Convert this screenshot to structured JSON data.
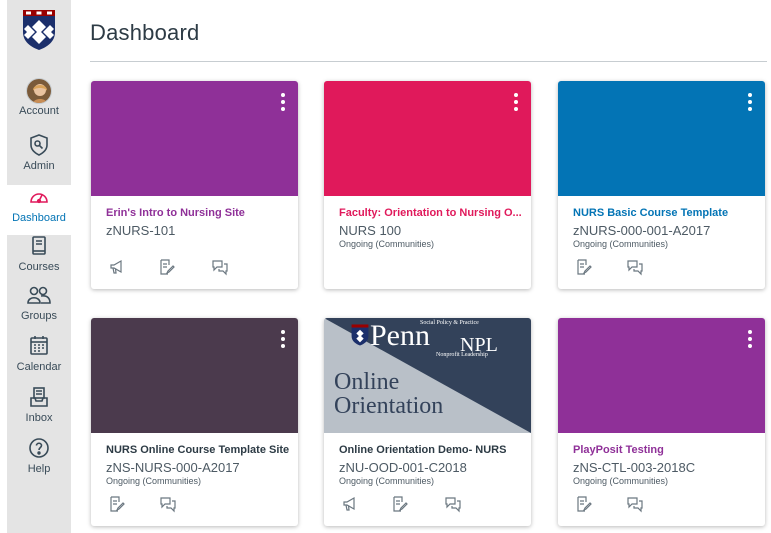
{
  "sidebar": {
    "items": [
      {
        "label": "Account",
        "icon": "avatar"
      },
      {
        "label": "Admin",
        "icon": "shield-icon"
      },
      {
        "label": "Dashboard",
        "icon": "gauge-icon"
      },
      {
        "label": "Courses",
        "icon": "book-icon"
      },
      {
        "label": "Groups",
        "icon": "people-icon"
      },
      {
        "label": "Calendar",
        "icon": "calendar-icon"
      },
      {
        "label": "Inbox",
        "icon": "inbox-icon"
      },
      {
        "label": "Help",
        "icon": "help-icon"
      }
    ],
    "active": "Dashboard"
  },
  "header": {
    "title": "Dashboard"
  },
  "colors": {
    "purple": "#8f3098",
    "pink": "#e0195b",
    "blue": "#0374b5",
    "plum": "#4b3a4d",
    "link_blue": "#0374b5"
  },
  "cards": [
    {
      "title": "Erin's Intro to Nursing Site",
      "code": "zNURS-101",
      "term": "",
      "color": "#8f3098",
      "icons": [
        "announcements-icon",
        "assignments-icon",
        "discussions-icon"
      ]
    },
    {
      "title": "Faculty: Orientation to Nursing O...",
      "code": "NURS 100",
      "term": "Ongoing (Communities)",
      "color": "#e0195b",
      "icons": []
    },
    {
      "title": "NURS Basic Course Template",
      "code": "zNURS-000-001-A2017",
      "term": "Ongoing (Communities)",
      "color": "#0374b5",
      "icons": [
        "assignments-icon",
        "discussions-icon"
      ]
    },
    {
      "title": "NURS Online Course Template Site",
      "code": "zNS-NURS-000-A2017",
      "term": "Ongoing (Communities)",
      "color": "#4b3a4d",
      "icons": [
        "assignments-icon",
        "discussions-icon"
      ]
    },
    {
      "title": "Online Orientation Demo- NURS",
      "code": "zNU-OOD-001-C2018",
      "term": "Ongoing (Communities)",
      "color": "#2d3b45",
      "icons": [
        "announcements-icon",
        "assignments-icon",
        "discussions-icon"
      ]
    },
    {
      "title": "PlayPosit Testing",
      "code": "zNS-CTL-003-2018C",
      "term": "Ongoing (Communities)",
      "color": "#8f3098",
      "icons": [
        "assignments-icon",
        "discussions-icon"
      ]
    }
  ],
  "orientation_image": {
    "line1": "Online",
    "line2": "Orientation",
    "brand": "Penn",
    "brand_suffix": "NPL",
    "tagline_top": "Social Policy & Practice",
    "tagline_bottom": "Nonprofit Leadership"
  }
}
